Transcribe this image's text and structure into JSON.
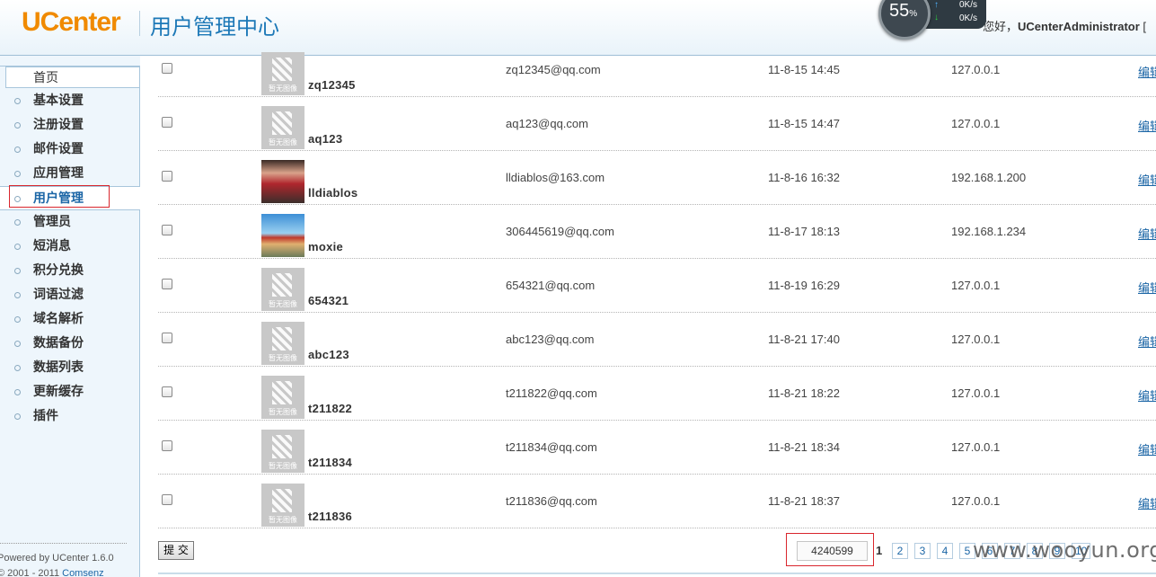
{
  "header": {
    "logo_u": "U",
    "logo_rest": "Center",
    "app_title": "用户管理中心",
    "greeting_prefix": "您好，",
    "admin_name": "UCenterAdministrator",
    "greeting_suffix": " ["
  },
  "speed_widget": {
    "percent": "55",
    "percent_sign": "%",
    "upload": "0K/s",
    "download": "0K/s"
  },
  "sidebar": {
    "items": [
      {
        "label": "首页"
      },
      {
        "label": "基本设置"
      },
      {
        "label": "注册设置"
      },
      {
        "label": "邮件设置"
      },
      {
        "label": "应用管理"
      },
      {
        "label": "用户管理"
      },
      {
        "label": "管理员"
      },
      {
        "label": "短消息"
      },
      {
        "label": "积分兑换"
      },
      {
        "label": "词语过滤"
      },
      {
        "label": "域名解析"
      },
      {
        "label": "数据备份"
      },
      {
        "label": "数据列表"
      },
      {
        "label": "更新缓存"
      },
      {
        "label": "插件"
      }
    ],
    "active_index": 5,
    "powered_by": "Powered by UCenter 1.6.0",
    "copyright_prefix": "© 2001 - 2011 ",
    "copyright_link": "Comsenz"
  },
  "avatar_placeholder_caption": "暂无图像",
  "users": [
    {
      "username": "zq12345",
      "email": "zq12345@qq.com",
      "regdate": "11-8-15 14:45",
      "ip": "127.0.0.1",
      "edit": "编辑",
      "avatar": "none"
    },
    {
      "username": "aq123",
      "email": "aq123@qq.com",
      "regdate": "11-8-15 14:47",
      "ip": "127.0.0.1",
      "edit": "编辑",
      "avatar": "none"
    },
    {
      "username": "lldiablos",
      "email": "lldiablos@163.com",
      "regdate": "11-8-16 16:32",
      "ip": "192.168.1.200",
      "edit": "编辑",
      "avatar": "photo1"
    },
    {
      "username": "moxie",
      "email": "306445619@qq.com",
      "regdate": "11-8-17 18:13",
      "ip": "192.168.1.234",
      "edit": "编辑",
      "avatar": "photo2"
    },
    {
      "username": "654321",
      "email": "654321@qq.com",
      "regdate": "11-8-19 16:29",
      "ip": "127.0.0.1",
      "edit": "编辑",
      "avatar": "none"
    },
    {
      "username": "abc123",
      "email": "abc123@qq.com",
      "regdate": "11-8-21 17:40",
      "ip": "127.0.0.1",
      "edit": "编辑",
      "avatar": "none"
    },
    {
      "username": "t211822",
      "email": "t211822@qq.com",
      "regdate": "11-8-21 18:22",
      "ip": "127.0.0.1",
      "edit": "编辑",
      "avatar": "none"
    },
    {
      "username": "t211834",
      "email": "t211834@qq.com",
      "regdate": "11-8-21 18:34",
      "ip": "127.0.0.1",
      "edit": "编辑",
      "avatar": "none"
    },
    {
      "username": "t211836",
      "email": "t211836@qq.com",
      "regdate": "11-8-21 18:37",
      "ip": "127.0.0.1",
      "edit": "编辑",
      "avatar": "none"
    }
  ],
  "footer": {
    "submit_label": "提 交",
    "total_count": "4240599",
    "current_page": "1",
    "pages": [
      "2",
      "3",
      "4",
      "5",
      "6",
      "7",
      "8",
      "9",
      "10"
    ],
    "watermark": "www.wooyun.org"
  },
  "colors": {
    "accent_blue": "#1c78b7",
    "logo_orange": "#f08a00",
    "highlight_red": "#d9262d"
  }
}
